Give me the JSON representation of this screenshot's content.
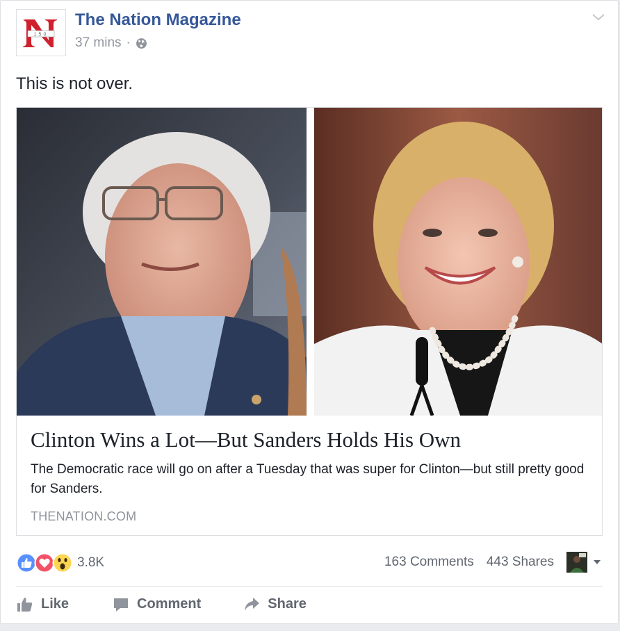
{
  "post": {
    "page_name": "The Nation Magazine",
    "timestamp": "37 mins",
    "separator": "·",
    "text": "This is not over.",
    "logo": {
      "letter": "N",
      "number": "150"
    }
  },
  "link": {
    "title": "Clinton Wins a Lot—But Sanders Holds His Own",
    "description": "The Democratic race will go on after a Tuesday that was super for Clinton—but still pretty good for Sanders.",
    "domain": "THENATION.COM"
  },
  "stats": {
    "reaction_count": "3.8K",
    "comments": "163 Comments",
    "shares": "443 Shares"
  },
  "actions": {
    "like": "Like",
    "comment": "Comment",
    "share": "Share"
  },
  "icons": {
    "globe": "globe-icon",
    "chevron": "chevron-down-icon",
    "like_reaction": "like-reaction-icon",
    "love_reaction": "love-reaction-icon",
    "wow_reaction": "wow-reaction-icon",
    "like_action": "thumbs-up-icon",
    "comment_action": "comment-icon",
    "share_action": "share-arrow-icon"
  },
  "colors": {
    "link_blue": "#365899",
    "meta_gray": "#90949c",
    "action_gray": "#616770",
    "logo_red": "#d0202e",
    "like_blue": "#5890ff",
    "love_red": "#f25268",
    "wow_yellow": "#fcd553"
  }
}
